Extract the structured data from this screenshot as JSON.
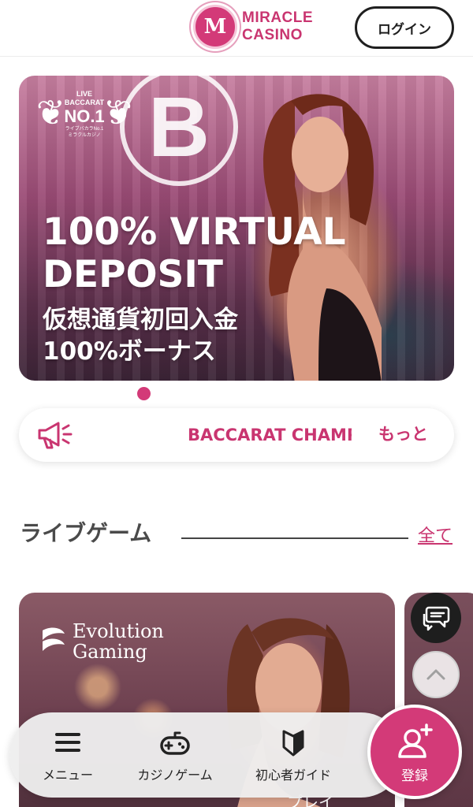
{
  "header": {
    "logo_letter": "M",
    "logo_line1": "MIRACLE",
    "logo_line2": "CASINO",
    "login_label": "ログイン"
  },
  "banner": {
    "badge_top": "LIVE",
    "badge_mid": "BACCARAT",
    "badge_rank": "NO.1",
    "badge_sub1": "ライブバカラNo.1",
    "badge_sub2": "ミラクルカジノ",
    "btc_symbol": "B",
    "title_line1": "100% VIRTUAL",
    "title_line2": "DEPOSIT",
    "jp_line1": "仮想通貨初回入金",
    "jp_line2": "100%ボーナス",
    "slide_index": 1
  },
  "announcement": {
    "icon": "megaphone-icon",
    "text": "BACCARAT CHAMPIONSHIP",
    "more_label": "もっと"
  },
  "live_games": {
    "title": "ライブゲーム",
    "all_label": "全て",
    "cards": [
      {
        "provider_line1": "Evolution",
        "provider_line2": "Gaming",
        "play_label": "プレイ"
      }
    ]
  },
  "floating": {
    "chat_icon": "chat-icon",
    "top_icon": "chevron-up-icon"
  },
  "bottom_nav": {
    "items": [
      {
        "label": "メニュー",
        "icon": "menu-icon"
      },
      {
        "label": "カジノゲーム",
        "icon": "gamepad-icon"
      },
      {
        "label": "初心者ガイド",
        "icon": "beginner-mark-icon"
      }
    ],
    "register_label": "登録",
    "register_icon": "add-user-icon"
  },
  "colors": {
    "brand": "#d33a78",
    "brand_text": "#c93570",
    "dark": "#1f1f1f"
  }
}
